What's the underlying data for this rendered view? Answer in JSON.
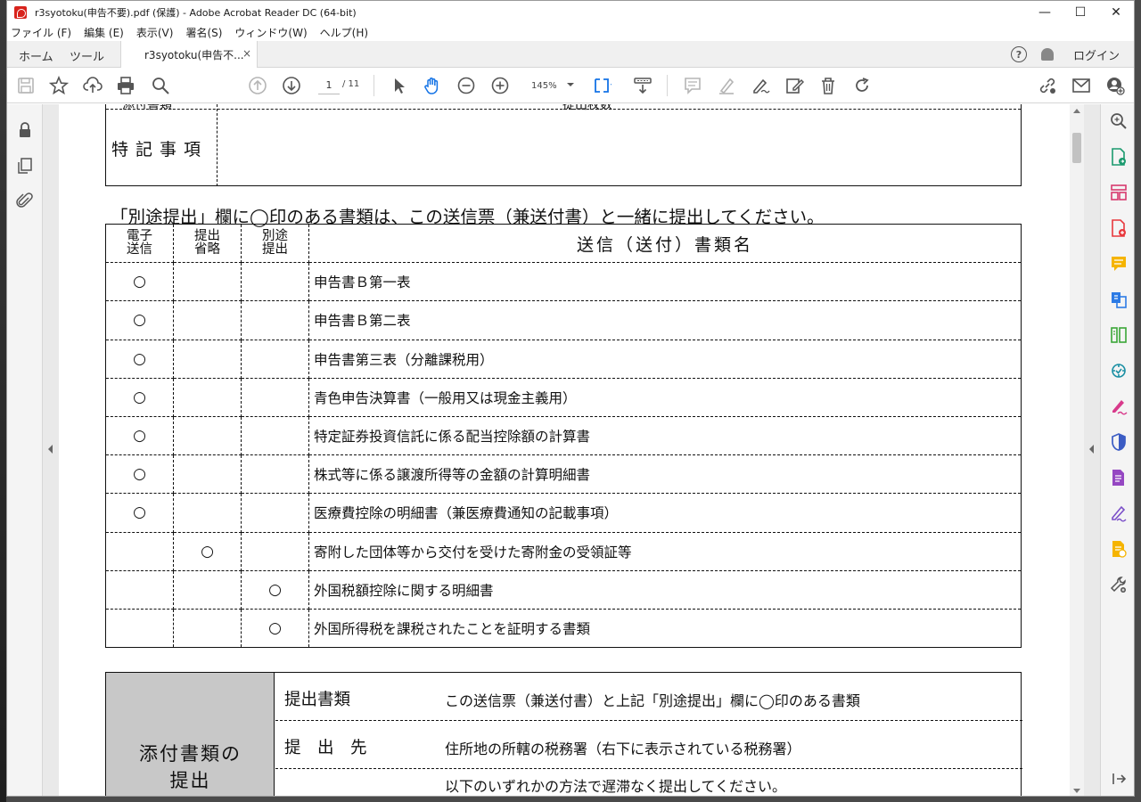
{
  "window": {
    "title": "r3syotoku(申告不要).pdf (保護) - Adobe Acrobat Reader DC (64-bit)",
    "controls": [
      "—",
      "☐",
      "✕"
    ]
  },
  "menu": [
    "ファイル (F)",
    "編集 (E)",
    "表示(V)",
    "署名(S)",
    "ウィンドウ(W)",
    "ヘルプ(H)"
  ],
  "tabs": {
    "home": "ホーム",
    "tools": "ツール",
    "document": "r3syotoku(申告不...",
    "close": "×",
    "help": "?",
    "login": "ログイン"
  },
  "toolbar": {
    "page_current": "1",
    "page_total": "/ 11",
    "zoom": "145%"
  },
  "colors": {
    "accent_blue": "#1473e6",
    "hand_tool_blue": "#1473e6",
    "attach_gray": "#c8c8c8"
  },
  "document": {
    "top_cut_text_left": "添付書類",
    "top_cut_text_right": "提出枚数",
    "special_notes": "特記事項",
    "notice": "「別途提出」欄に◯印のある書類は、この送信票（兼送付書）と一緒に提出してください。",
    "table": {
      "headers": [
        "電子\n送信",
        "提出\n省略",
        "別途\n提出",
        "送信（送付）書類名"
      ],
      "rows": [
        {
          "e": "○",
          "omit": "",
          "separate": "",
          "name": "申告書Ｂ第一表"
        },
        {
          "e": "○",
          "omit": "",
          "separate": "",
          "name": "申告書Ｂ第二表"
        },
        {
          "e": "○",
          "omit": "",
          "separate": "",
          "name": "申告書第三表（分離課税用）"
        },
        {
          "e": "○",
          "omit": "",
          "separate": "",
          "name": "青色申告決算書（一般用又は現金主義用）"
        },
        {
          "e": "○",
          "omit": "",
          "separate": "",
          "name": "特定証券投資信託に係る配当控除額の計算書"
        },
        {
          "e": "○",
          "omit": "",
          "separate": "",
          "name": "株式等に係る譲渡所得等の金額の計算明細書"
        },
        {
          "e": "○",
          "omit": "",
          "separate": "",
          "name": "医療費控除の明細書（兼医療費通知の記載事項）"
        },
        {
          "e": "",
          "omit": "○",
          "separate": "",
          "name": "寄附した団体等から交付を受けた寄附金の受領証等"
        },
        {
          "e": "",
          "omit": "",
          "separate": "○",
          "name": "外国税額控除に関する明細書"
        },
        {
          "e": "",
          "omit": "",
          "separate": "○",
          "name": "外国所得税を課税されたことを証明する書類"
        }
      ]
    },
    "attach": {
      "title_line1": "添付書類の",
      "title_line2": "提出",
      "rows": [
        {
          "label": "提出書類",
          "value": "この送信票（兼送付書）と上記「別途提出」欄に◯印のある書類"
        },
        {
          "label": "提　出　先",
          "value": "住所地の所轄の税務署（右下に表示されている税務署）"
        },
        {
          "label": "",
          "value": "以下のいずれかの方法で遅滞なく提出してください。"
        }
      ]
    }
  }
}
